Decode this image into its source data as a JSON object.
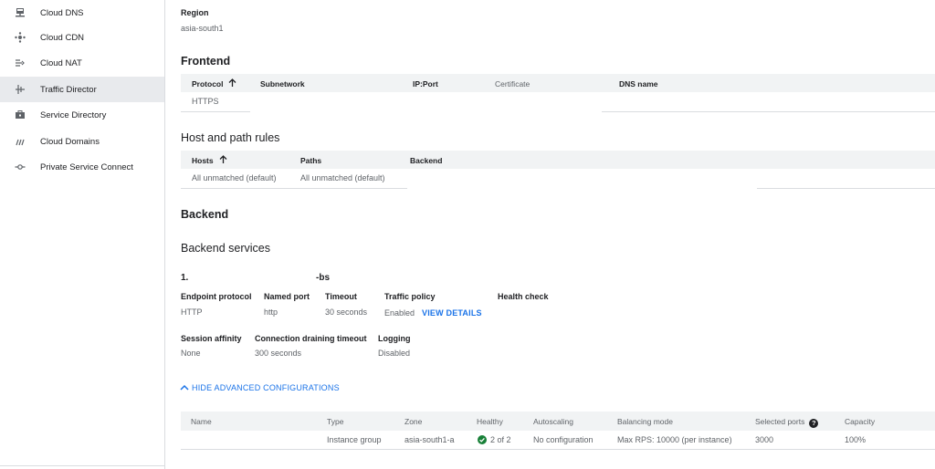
{
  "sidebar": {
    "items": [
      {
        "label": "Cloud DNS",
        "icon": "dns-icon"
      },
      {
        "label": "Cloud CDN",
        "icon": "cdn-icon"
      },
      {
        "label": "Cloud NAT",
        "icon": "nat-icon"
      },
      {
        "label": "Traffic Director",
        "icon": "traffic-director-icon",
        "active": true
      },
      {
        "label": "Service Directory",
        "icon": "service-directory-icon"
      },
      {
        "label": "Cloud Domains",
        "icon": "cloud-domains-icon"
      },
      {
        "label": "Private Service Connect",
        "icon": "private-service-connect-icon"
      }
    ]
  },
  "region": {
    "label": "Region",
    "value": "asia-south1"
  },
  "frontend": {
    "title": "Frontend",
    "headers": {
      "protocol": "Protocol",
      "subnetwork": "Subnetwork",
      "ip_port": "IP:Port",
      "certificate": "Certificate",
      "dns_name": "DNS name"
    },
    "row": {
      "protocol": "HTTPS"
    }
  },
  "host_path": {
    "title": "Host and path rules",
    "headers": {
      "hosts": "Hosts",
      "paths": "Paths",
      "backend": "Backend"
    },
    "row": {
      "hosts": "All unmatched (default)",
      "paths": "All unmatched (default)"
    }
  },
  "backend": {
    "title": "Backend",
    "services_title": "Backend services",
    "service": {
      "index": "1.",
      "name_suffix": "-bs",
      "endpoint_protocol": {
        "label": "Endpoint protocol",
        "value": "HTTP"
      },
      "named_port": {
        "label": "Named port",
        "value": "http"
      },
      "timeout": {
        "label": "Timeout",
        "value": "30 seconds"
      },
      "traffic_policy": {
        "label": "Traffic policy",
        "value": "Enabled",
        "link": "VIEW DETAILS"
      },
      "health_check": {
        "label": "Health check"
      },
      "session_affinity": {
        "label": "Session affinity",
        "value": "None"
      },
      "connection_draining": {
        "label": "Connection draining timeout",
        "value": "300 seconds"
      },
      "logging": {
        "label": "Logging",
        "value": "Disabled"
      }
    },
    "advanced_toggle": "HIDE ADVANCED CONFIGURATIONS",
    "table": {
      "headers": {
        "name": "Name",
        "type": "Type",
        "zone": "Zone",
        "healthy": "Healthy",
        "autoscaling": "Autoscaling",
        "balancing_mode": "Balancing mode",
        "selected_ports": "Selected ports",
        "capacity": "Capacity"
      },
      "row": {
        "type": "Instance group",
        "zone": "asia-south1-a",
        "healthy": "2 of 2",
        "autoscaling": "No configuration",
        "balancing_mode": "Max RPS: 10000 (per instance)",
        "selected_ports": "3000",
        "capacity": "100%"
      }
    }
  },
  "colors": {
    "link": "#1a73e8",
    "healthy": "#188038",
    "active_nav": "#e8eaed",
    "table_header": "#f1f3f4"
  }
}
